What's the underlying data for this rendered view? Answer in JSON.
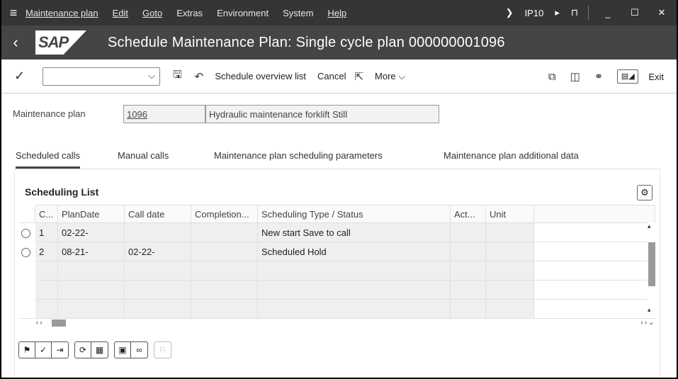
{
  "menu": {
    "items": [
      "Maintenance plan",
      "Edit",
      "Goto",
      "Extras",
      "Environment",
      "System",
      "Help"
    ],
    "system_id": "IP10"
  },
  "title": {
    "logo_text": "SAP",
    "text": "Schedule Maintenance Plan: Single cycle plan 000000001096"
  },
  "toolbar": {
    "schedule_overview": "Schedule overview list",
    "cancel": "Cancel",
    "more": "More",
    "exit": "Exit"
  },
  "fields": {
    "plan_label": "Maintenance plan",
    "plan_number": "1096",
    "plan_description": "Hydraulic maintenance forklift Still"
  },
  "tabs": [
    "Scheduled calls",
    "Manual calls",
    "Maintenance plan scheduling parameters",
    "Maintenance plan additional data"
  ],
  "list": {
    "title": "Scheduling List",
    "columns": [
      "C...",
      "PlanDate",
      "Call date",
      "Completion...",
      "Scheduling Type / Status",
      "Act...",
      "Unit"
    ],
    "rows": [
      [
        "1",
        "02-22-",
        "",
        "",
        "New start  Save to call",
        "",
        ""
      ],
      [
        "2",
        "08-21-",
        "02-22-",
        "",
        "Scheduled  Hold",
        "",
        ""
      ]
    ]
  },
  "icons": {
    "hamburger": "menu-icon",
    "back": "back-arrow-icon",
    "check": "checkmark-icon",
    "save": "save-icon",
    "undo": "undo-icon",
    "gear": "gear-icon"
  }
}
